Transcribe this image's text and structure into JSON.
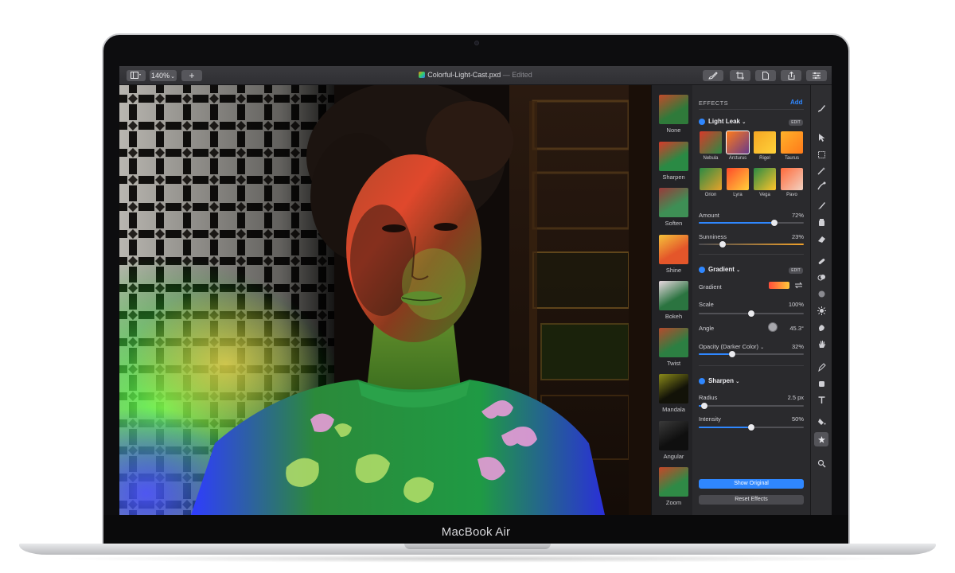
{
  "device": {
    "label": "MacBook Air"
  },
  "toolbar": {
    "zoom": "140%",
    "zoom_arrow": "⌄",
    "add_label": "+",
    "document_name": "Colorful-Light-Cast.pxd",
    "document_status": "— Edited",
    "icons": [
      "sidebar-view-icon",
      "brush-icon",
      "crop-icon",
      "document-icon",
      "share-icon",
      "adjust-icon"
    ]
  },
  "effects_strip": [
    {
      "label": "None",
      "colors": [
        "#2f7a3a",
        "#c24a2a"
      ]
    },
    {
      "label": "Sharpen",
      "colors": [
        "#2a8a44",
        "#d83a2a"
      ]
    },
    {
      "label": "Soften",
      "colors": [
        "#3e8f55",
        "#9a3a3a"
      ]
    },
    {
      "label": "Shine",
      "colors": [
        "#e4562a",
        "#f5c23a"
      ]
    },
    {
      "label": "Bokeh",
      "colors": [
        "#2b7440",
        "#e8d8e0"
      ]
    },
    {
      "label": "Twist",
      "colors": [
        "#2c7f42",
        "#b54a2d"
      ]
    },
    {
      "label": "Mandala",
      "colors": [
        "#121208",
        "#8a8a1a"
      ]
    },
    {
      "label": "Angular",
      "colors": [
        "#0f0f0f",
        "#3a3a3a"
      ]
    },
    {
      "label": "Zoom",
      "colors": [
        "#2f8a46",
        "#c84628"
      ]
    }
  ],
  "panel": {
    "header": "EFFECTS",
    "add_label": "Add",
    "light_leak": {
      "title": "Light Leak",
      "caret": "⌄",
      "edit_label": "EDIT",
      "presets": [
        {
          "label": "Nebula",
          "colors": [
            "#d83a2a",
            "#2b8a44"
          ]
        },
        {
          "label": "Arcturus",
          "colors": [
            "#ff7b1a",
            "#6a3a8a"
          ]
        },
        {
          "label": "Rigel",
          "colors": [
            "#f5a623",
            "#ffd23a"
          ]
        },
        {
          "label": "Taurus",
          "colors": [
            "#ffb22a",
            "#ff7a1a"
          ]
        },
        {
          "label": "Orion",
          "colors": [
            "#2c8a44",
            "#e6a22a"
          ]
        },
        {
          "label": "Lyra",
          "colors": [
            "#ff4a2a",
            "#ffd03a"
          ]
        },
        {
          "label": "Vega",
          "colors": [
            "#2b8a44",
            "#ffc42a"
          ]
        },
        {
          "label": "Pavo",
          "colors": [
            "#ff6a3a",
            "#f2d2c2"
          ]
        }
      ],
      "selected_preset": "Arcturus",
      "amount": {
        "label": "Amount",
        "value_text": "72%",
        "value": 0.72
      },
      "sunniness": {
        "label": "Sunniness",
        "value_text": "23%",
        "value": 0.23
      }
    },
    "gradient": {
      "title": "Gradient",
      "caret": "⌄",
      "edit_label": "EDIT",
      "gradient_label": "Gradient",
      "scale": {
        "label": "Scale",
        "value_text": "100%",
        "value": 0.5
      },
      "angle": {
        "label": "Angle",
        "value_text": "45.3°"
      },
      "opacity": {
        "label": "Opacity (Darker Color)",
        "caret": "⌄",
        "value_text": "32%",
        "value": 0.32
      }
    },
    "sharpen": {
      "title": "Sharpen",
      "caret": "⌄",
      "radius": {
        "label": "Radius",
        "value_text": "2.5 px",
        "value": 0.05
      },
      "intensity": {
        "label": "Intensity",
        "value_text": "50%",
        "value": 0.5
      }
    },
    "show_original_label": "Show Original",
    "reset_effects_label": "Reset Effects"
  },
  "tools": [
    "select-icon",
    "rectangle-select-icon",
    "magic-wand-icon",
    "quick-select-icon",
    "brush-tool-icon",
    "fill-icon",
    "eraser-icon",
    "repair-icon",
    "clone-icon",
    "blur-icon",
    "light-icon",
    "smudge-icon",
    "hand-icon",
    "pen-icon",
    "shape-icon",
    "text-icon",
    "color-fill-icon",
    "effects-star-icon",
    "zoom-icon"
  ],
  "colors": {
    "accent": "#2f87ff",
    "panel_bg": "#2a2a2d",
    "toolbar_bg": "#333337"
  }
}
